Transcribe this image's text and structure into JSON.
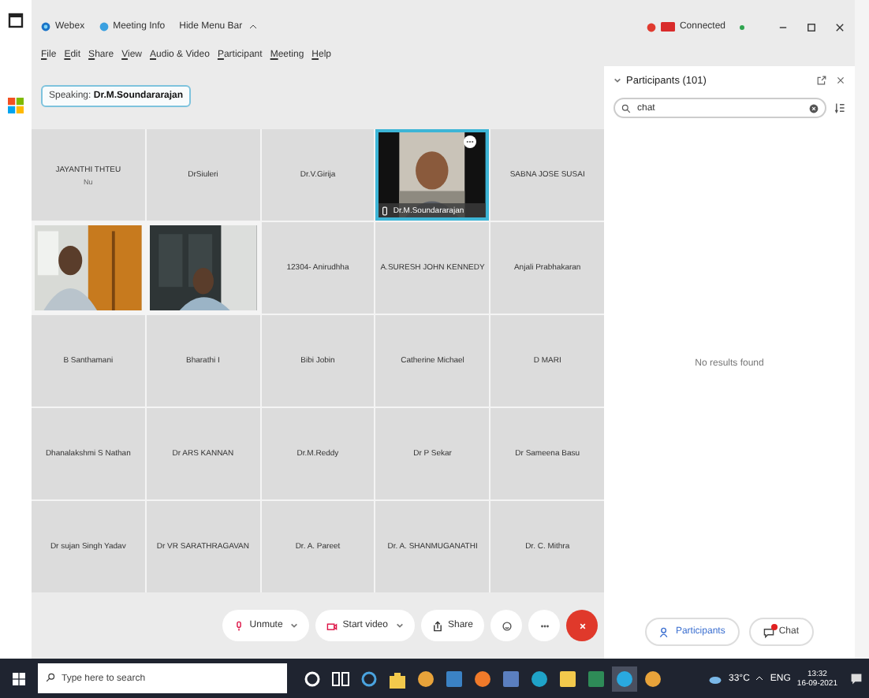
{
  "title_bar": {
    "app": "Webex",
    "meeting_info": "Meeting Info",
    "hide_menu": "Hide Menu Bar",
    "status": "Connected"
  },
  "menu": [
    "File",
    "Edit",
    "Share",
    "View",
    "Audio & Video",
    "Participant",
    "Meeting",
    "Help"
  ],
  "speaking": {
    "label": "Speaking:",
    "name": "Dr.M.Soundararajan"
  },
  "tiles": [
    {
      "kind": "name",
      "name": "JAYANTHI THTEU",
      "sub": "Nu",
      "speaking": false
    },
    {
      "kind": "name",
      "name": "DrSiuleri",
      "speaking": false
    },
    {
      "kind": "name",
      "name": "Dr.V.Girija",
      "speaking": false
    },
    {
      "kind": "video",
      "name": "Dr.M.Soundararajan",
      "speaking": true
    },
    {
      "kind": "name",
      "name": "SABNA JOSE SUSAI",
      "speaking": false
    },
    {
      "kind": "video",
      "speaking": false
    },
    {
      "kind": "video",
      "speaking": false
    },
    {
      "kind": "name",
      "name": "12304- Anirudhha",
      "speaking": false
    },
    {
      "kind": "name",
      "name": "A.SURESH JOHN KENNEDY",
      "speaking": false
    },
    {
      "kind": "name",
      "name": "Anjali Prabhakaran",
      "speaking": false
    },
    {
      "kind": "name",
      "name": "B Santhamani",
      "speaking": false
    },
    {
      "kind": "name",
      "name": "Bharathi I",
      "speaking": false
    },
    {
      "kind": "name",
      "name": "Bibi Jobin",
      "speaking": false
    },
    {
      "kind": "name",
      "name": "Catherine Michael",
      "speaking": false
    },
    {
      "kind": "name",
      "name": "D MARI",
      "speaking": false
    },
    {
      "kind": "name",
      "name": "Dhanalakshmi S Nathan",
      "speaking": false
    },
    {
      "kind": "name",
      "name": "Dr ARS KANNAN",
      "speaking": false
    },
    {
      "kind": "name",
      "name": "Dr.M.Reddy",
      "speaking": false
    },
    {
      "kind": "name",
      "name": "Dr P Sekar",
      "speaking": false
    },
    {
      "kind": "name",
      "name": "Dr Sameena Basu",
      "speaking": false
    },
    {
      "kind": "name",
      "name": "Dr sujan Singh Yadav",
      "speaking": false
    },
    {
      "kind": "name",
      "name": "Dr VR SARATHRAGAVAN",
      "speaking": false
    },
    {
      "kind": "name",
      "name": "Dr. A. Pareet",
      "speaking": false
    },
    {
      "kind": "name",
      "name": "Dr. A. SHANMUGANATHI",
      "speaking": false
    },
    {
      "kind": "name",
      "name": "Dr. C. Mithra",
      "speaking": false
    }
  ],
  "controls": [
    {
      "kind": "unmute",
      "label": "Unmute",
      "dropdown": true
    },
    {
      "kind": "video",
      "label": "Start video",
      "dropdown": true
    },
    {
      "kind": "share",
      "label": "Share",
      "dropdown": false
    },
    {
      "kind": "reactions",
      "dropdown": false
    },
    {
      "kind": "more",
      "dropdown": false
    },
    {
      "kind": "end",
      "dropdown": false
    }
  ],
  "panel": {
    "title": "Participants (101)",
    "search": "chat",
    "empty": "No results found",
    "buttons": [
      {
        "kind": "participants",
        "label": "Participants",
        "alert": false
      },
      {
        "kind": "chat",
        "label": "Chat",
        "alert": true
      }
    ]
  },
  "taskbar": {
    "search_placeholder": "Type here to search",
    "apps": [
      {
        "kind": "cortana",
        "active": false
      },
      {
        "kind": "taskview",
        "active": false
      },
      {
        "kind": "circle",
        "active": false
      },
      {
        "kind": "store",
        "active": false
      },
      {
        "kind": "chrome",
        "active": false
      },
      {
        "kind": "mail",
        "active": false
      },
      {
        "kind": "firefox",
        "active": false
      },
      {
        "kind": "doc",
        "active": false
      },
      {
        "kind": "edge",
        "active": false
      },
      {
        "kind": "folder",
        "active": false
      },
      {
        "kind": "sheet",
        "active": false
      },
      {
        "kind": "webex",
        "active": true
      },
      {
        "kind": "chrome",
        "active": false
      }
    ],
    "weather": "33°C",
    "language": "ENG",
    "time": "13:32",
    "date": "16-09-2021"
  }
}
